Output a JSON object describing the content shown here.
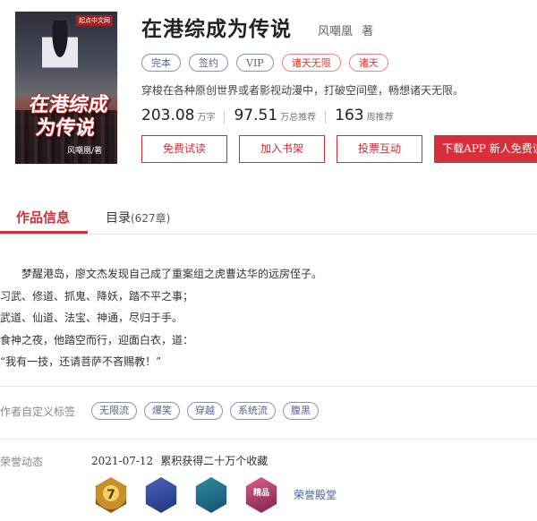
{
  "cover": {
    "title": "在港综成为传说",
    "author": "风嘲凰/著",
    "publisher": "起点中文网"
  },
  "book": {
    "title": "在港综成为传说",
    "author": "风嘲凰",
    "author_suffix": "著",
    "tags": [
      {
        "label": "完本",
        "style": "blue"
      },
      {
        "label": "签约",
        "style": "blue"
      },
      {
        "label": "VIP",
        "style": "blue"
      },
      {
        "label": "诸天无限",
        "style": "red"
      },
      {
        "label": "诸天",
        "style": "red"
      }
    ],
    "intro": "穿梭在各种原创世界或者影视动漫中，打破空间壁，畅想诸天无限。",
    "stats": [
      {
        "value": "203.08",
        "unit": "万字"
      },
      {
        "value": "97.51",
        "unit": "万总推荐"
      },
      {
        "value": "163",
        "unit": "周推荐"
      }
    ]
  },
  "buttons": {
    "read": "免费试读",
    "shelf": "加入书架",
    "vote": "投票互动",
    "download": "下载APP  新人免费读"
  },
  "tabs": {
    "info": "作品信息",
    "toc": "目录",
    "toc_count": "(627章)"
  },
  "synopsis": [
    "梦醒港岛，廖文杰发现自己成了重案组之虎曹达华的远房侄子。",
    "习武、修道、抓鬼、降妖，踏不平之事；",
    "武道、仙道、法宝、神通，尽归于手。",
    "食神之夜，他踏空而行，迎面白衣，道：",
    "“我有一技，还请菩萨不吝赐教！”"
  ],
  "custom_tags": {
    "label": "作者自定义标签",
    "items": [
      "无限流",
      "爆笑",
      "穿越",
      "系统流",
      "腹黑"
    ]
  },
  "honor": {
    "label": "荣誉动态",
    "date": "2021-07-12",
    "text": "累积获得二十万个收藏",
    "medals": [
      "7",
      "",
      "",
      "精品"
    ],
    "hall_link": "荣誉殿堂"
  },
  "colors": {
    "accent": "#c9333b",
    "tag_blue": "#5a638a",
    "link": "#3f5fa8"
  }
}
